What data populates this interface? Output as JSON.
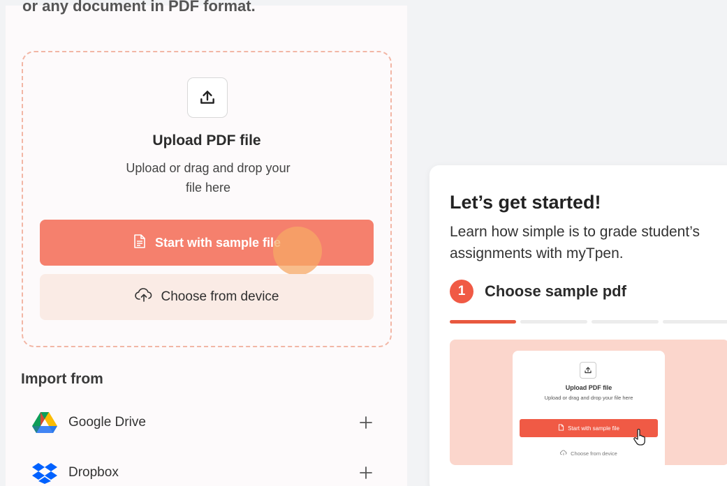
{
  "left_panel": {
    "top_text": "or any document in PDF format.",
    "dropzone": {
      "title": "Upload PDF file",
      "subtitle": "Upload or drag and drop your file here",
      "sample_button_label": "Start with sample file",
      "device_button_label": "Choose from device",
      "upload_icon": "upload-icon"
    },
    "import": {
      "title": "Import from",
      "sources": [
        {
          "label": "Google Drive",
          "icon": "google-drive-icon"
        },
        {
          "label": "Dropbox",
          "icon": "dropbox-icon"
        }
      ]
    }
  },
  "card": {
    "title": "Let’s get started!",
    "description": "Learn how simple is to grade student’s assignments with myTpen.",
    "step": {
      "number": "1",
      "label": "Choose sample pdf"
    },
    "progress": {
      "current": 1,
      "total": 4
    },
    "preview": {
      "title": "Upload PDF file",
      "subtitle": "Upload or drag and drop your file here",
      "sample_button_label": "Start with sample file",
      "device_button_label": "Choose from device"
    }
  },
  "colors": {
    "accent": "#f5806d",
    "accent_dark": "#f05a45",
    "secondary_bg": "#faebe5",
    "dash_border": "#f2b6a5"
  }
}
